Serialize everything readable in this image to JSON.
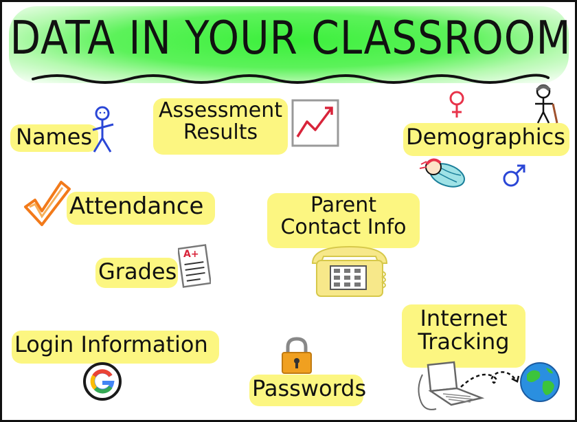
{
  "title": "DATA IN YOUR CLASSROOM",
  "labels": {
    "names": "Names",
    "assessment_line1": "Assessment",
    "assessment_line2": "Results",
    "demographics": "Demographics",
    "attendance": "Attendance",
    "parent_line1": "Parent",
    "parent_line2": "Contact Info",
    "grades": "Grades",
    "grade_mark": "A+",
    "login": "Login Information",
    "passwords": "Passwords",
    "internet_line1": "Internet",
    "internet_line2": "Tracking"
  },
  "icons": {
    "stick_figure": "stick-figure-icon",
    "line_chart": "line-chart-icon",
    "female_symbol": "female-symbol-icon",
    "male_symbol": "male-symbol-icon",
    "elderly_person": "elderly-person-icon",
    "baby": "baby-icon",
    "checkmark": "checkmark-icon",
    "telephone": "telephone-icon",
    "graded_paper": "graded-paper-icon",
    "google_logo": "google-logo-icon",
    "padlock": "padlock-icon",
    "laptop": "laptop-icon",
    "globe": "globe-icon"
  },
  "colors": {
    "highlight": "#fcf57a",
    "title_glow": "#3cf03c",
    "female": "#e8334a",
    "male": "#2a46d6",
    "check": "#f27a1a",
    "phone": "#f7e88a",
    "lock": "#f0a020",
    "globe_water": "#2a8fe0",
    "globe_land": "#3cc43c"
  }
}
